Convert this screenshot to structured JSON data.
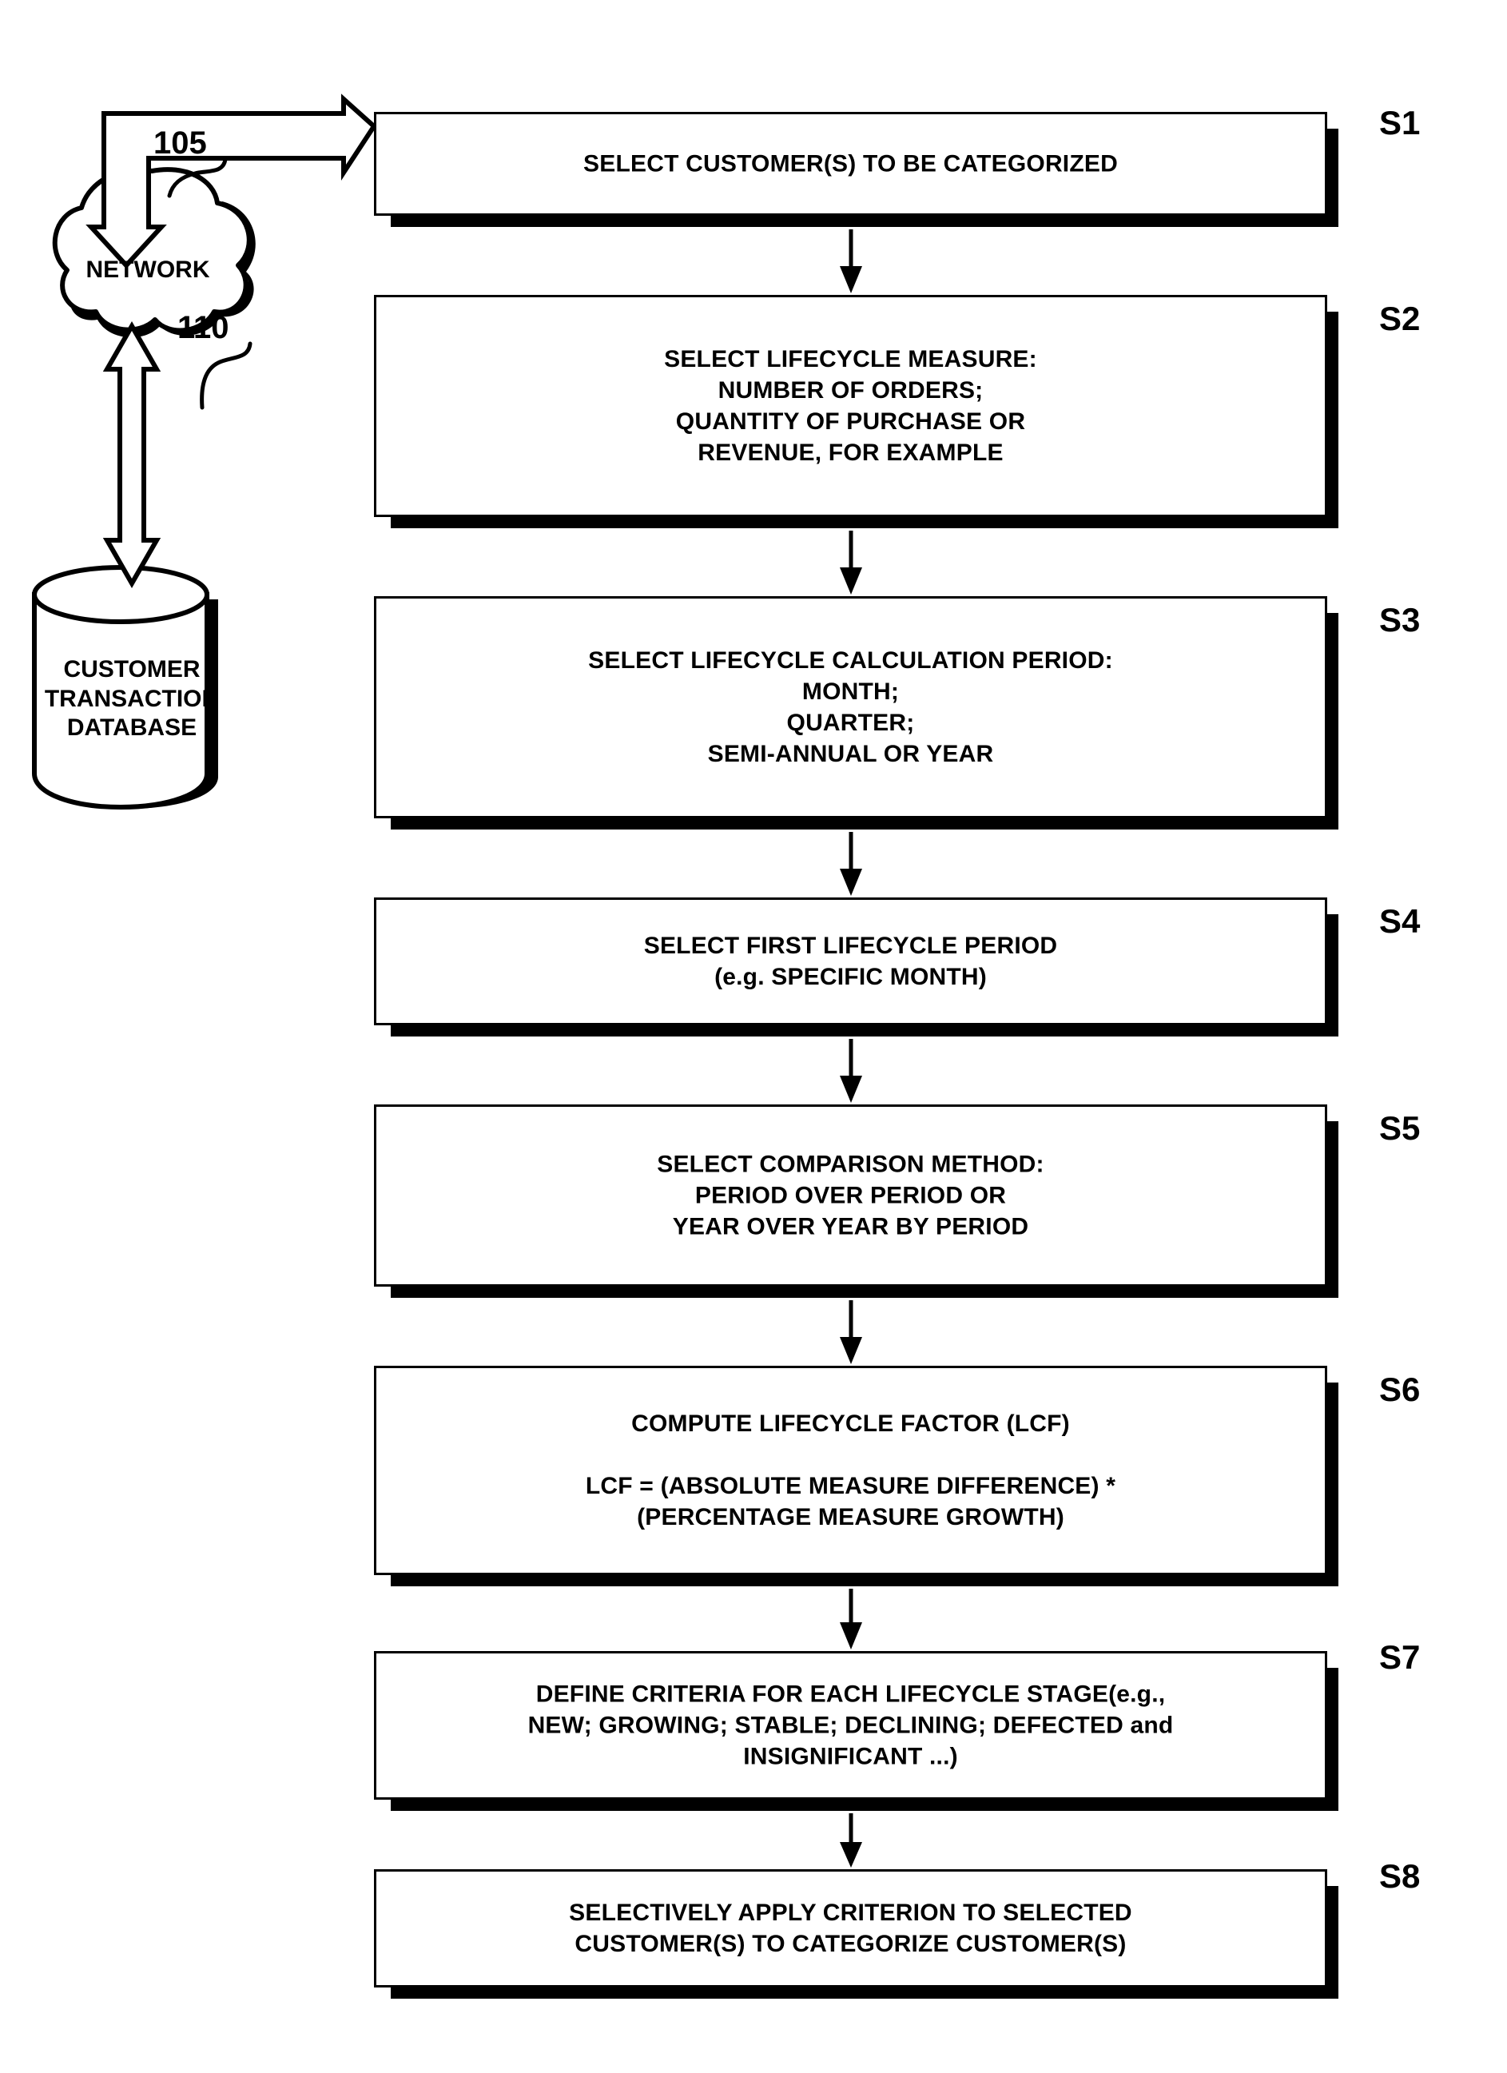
{
  "figure": {
    "type": "patent-flowchart",
    "background_color": "#ffffff",
    "line_color": "#000000"
  },
  "system": {
    "network": {
      "label": "NETWORK",
      "ref": "105",
      "shape": "cloud-icon"
    },
    "database": {
      "label": "CUSTOMER\nTRANSACTION\nDATABASE",
      "ref": "110",
      "shape": "cylinder-icon"
    }
  },
  "steps": [
    {
      "id": "S1",
      "label": "S1",
      "text": "SELECT CUSTOMER(S) TO BE CATEGORIZED"
    },
    {
      "id": "S2",
      "label": "S2",
      "text": "SELECT LIFECYCLE MEASURE:\nNUMBER OF ORDERS;\nQUANTITY OF PURCHASE OR\nREVENUE, FOR EXAMPLE"
    },
    {
      "id": "S3",
      "label": "S3",
      "text": "SELECT LIFECYCLE CALCULATION PERIOD:\nMONTH;\nQUARTER;\nSEMI-ANNUAL OR YEAR"
    },
    {
      "id": "S4",
      "label": "S4",
      "text": "SELECT FIRST LIFECYCLE PERIOD\n(e.g. SPECIFIC MONTH)"
    },
    {
      "id": "S5",
      "label": "S5",
      "text": "SELECT COMPARISON METHOD:\nPERIOD OVER PERIOD OR\nYEAR OVER YEAR BY PERIOD"
    },
    {
      "id": "S6",
      "label": "S6",
      "text": "COMPUTE LIFECYCLE FACTOR (LCF)\n\nLCF = (ABSOLUTE MEASURE DIFFERENCE) *\n(PERCENTAGE MEASURE GROWTH)"
    },
    {
      "id": "S7",
      "label": "S7",
      "text": "DEFINE CRITERIA FOR EACH LIFECYCLE STAGE(e.g.,\nNEW; GROWING; STABLE; DECLINING; DEFECTED and\nINSIGNIFICANT ...)"
    },
    {
      "id": "S8",
      "label": "S8",
      "text": "SELECTIVELY APPLY CRITERION TO SELECTED\nCUSTOMER(S) TO CATEGORIZE CUSTOMER(S)"
    }
  ]
}
